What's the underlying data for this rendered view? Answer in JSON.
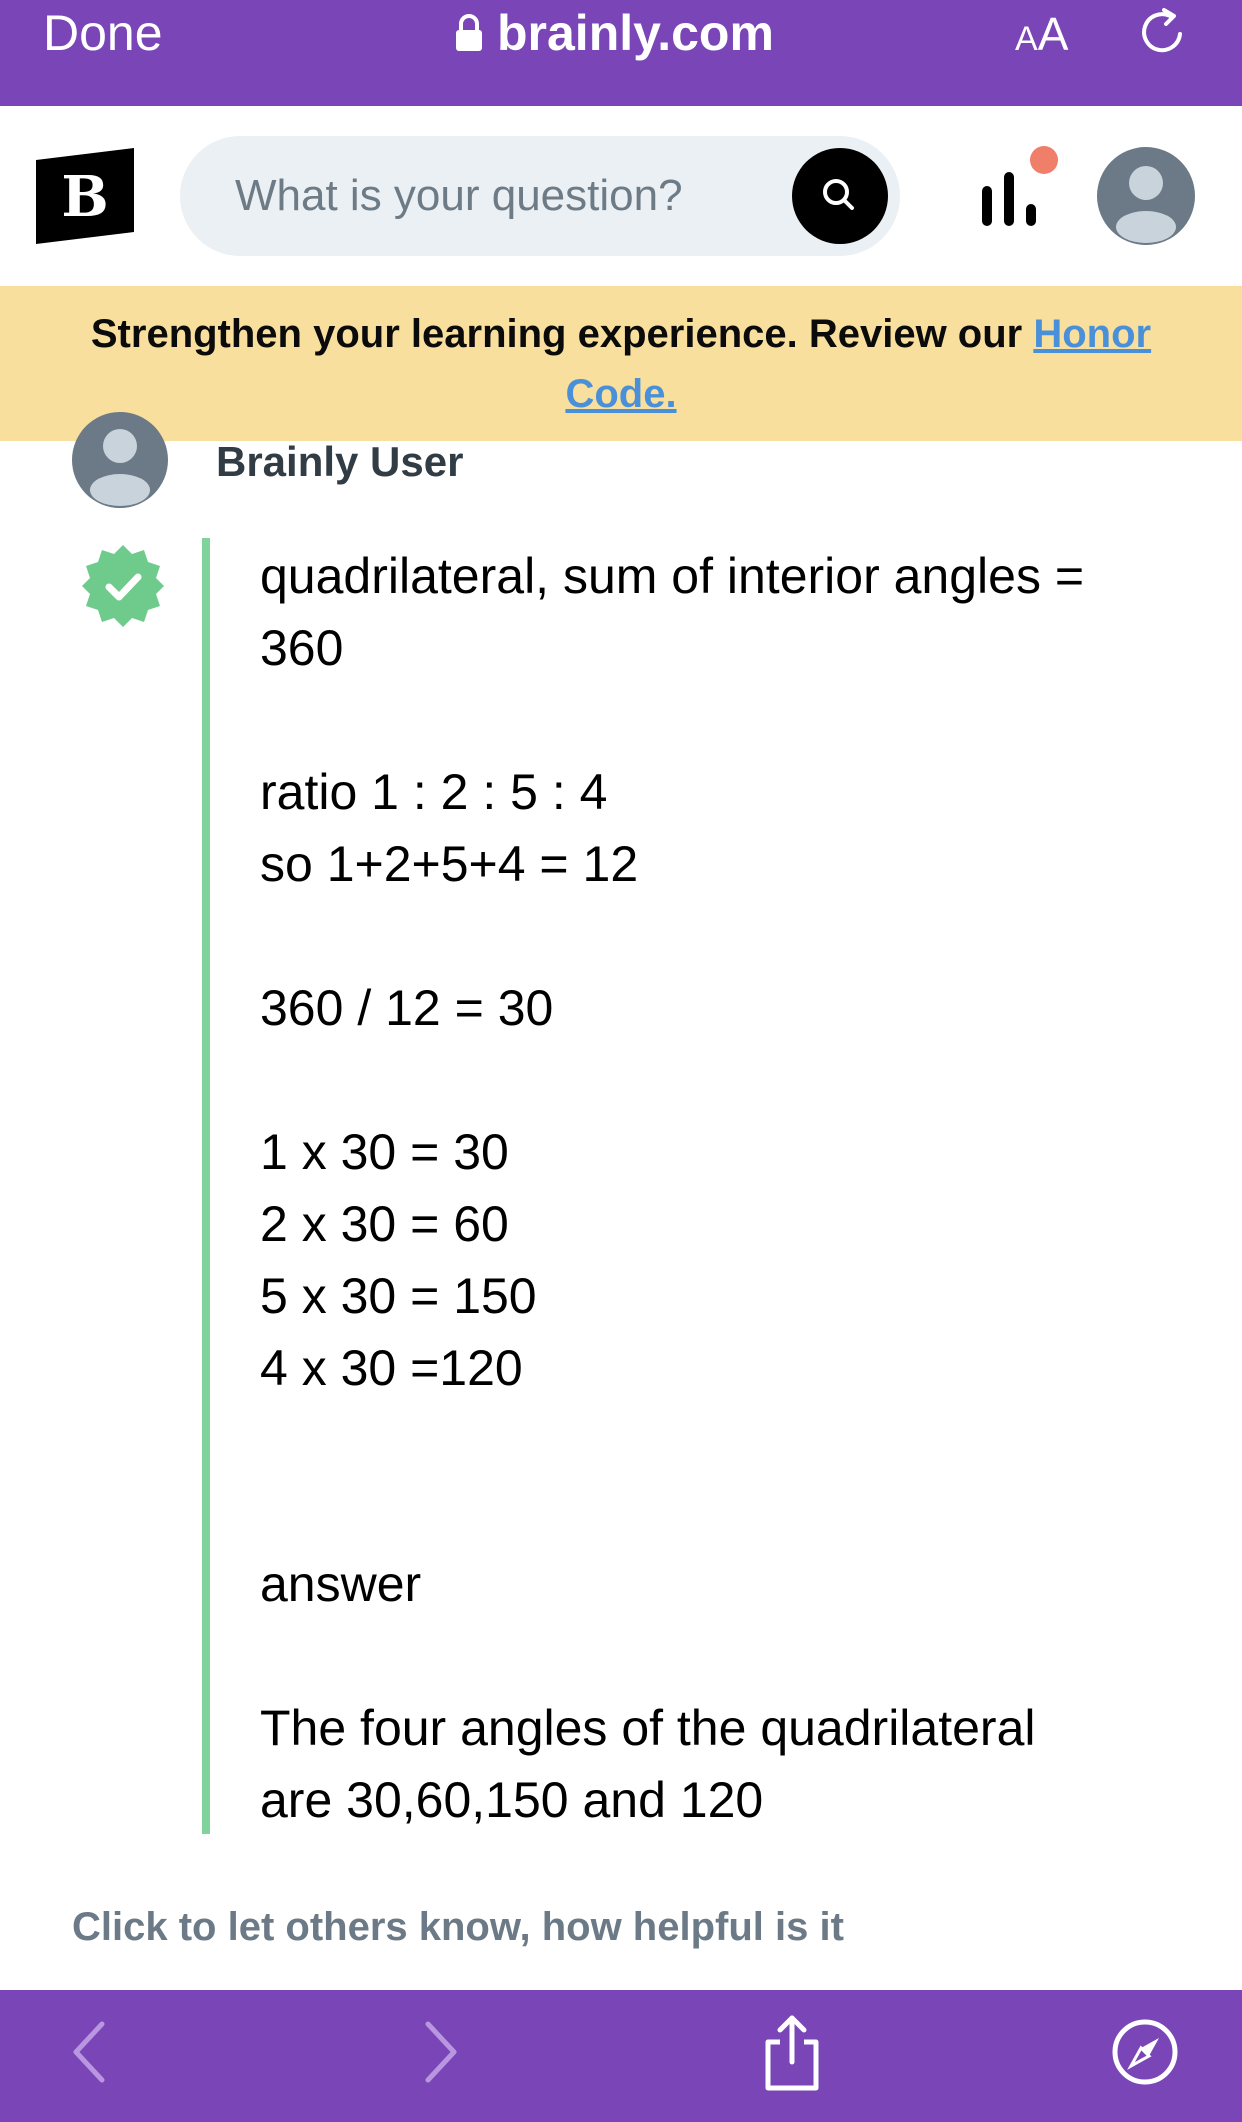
{
  "browser": {
    "done_label": "Done",
    "url": "brainly.com",
    "text_size_label_small": "A",
    "text_size_label_large": "A",
    "reload_icon": "reload-icon",
    "bar_color": "#7a45b7"
  },
  "header": {
    "logo_letter": "B",
    "search_placeholder": "What is your question?",
    "search_icon": "search-icon",
    "stats_icon": "stats-icon",
    "notification_color": "#f07f6a"
  },
  "banner": {
    "text": "Strengthen your learning experience. Review our ",
    "link_text": "Honor Code."
  },
  "answer": {
    "author": "Brainly User",
    "verified_color": "#6ecb8b",
    "lines": [
      "quadrilateral, sum of interior angles =",
      "360",
      "",
      "ratio 1 : 2 : 5 : 4",
      "so 1+2+5+4 = 12",
      "",
      "360 / 12 = 30",
      "",
      "1 x 30 = 30",
      "2 x 30 = 60",
      "5 x 30 = 150",
      "4 x 30 =120",
      "",
      "",
      "answer",
      "",
      "The four angles of the quadrilateral",
      "are 30,60,150 and 120"
    ]
  },
  "feedback": {
    "prompt": "Click to let others know, how helpful is it"
  },
  "toolbar": {
    "back_icon": "back-icon",
    "forward_icon": "forward-icon",
    "share_icon": "share-icon",
    "compass_icon": "compass-icon"
  }
}
